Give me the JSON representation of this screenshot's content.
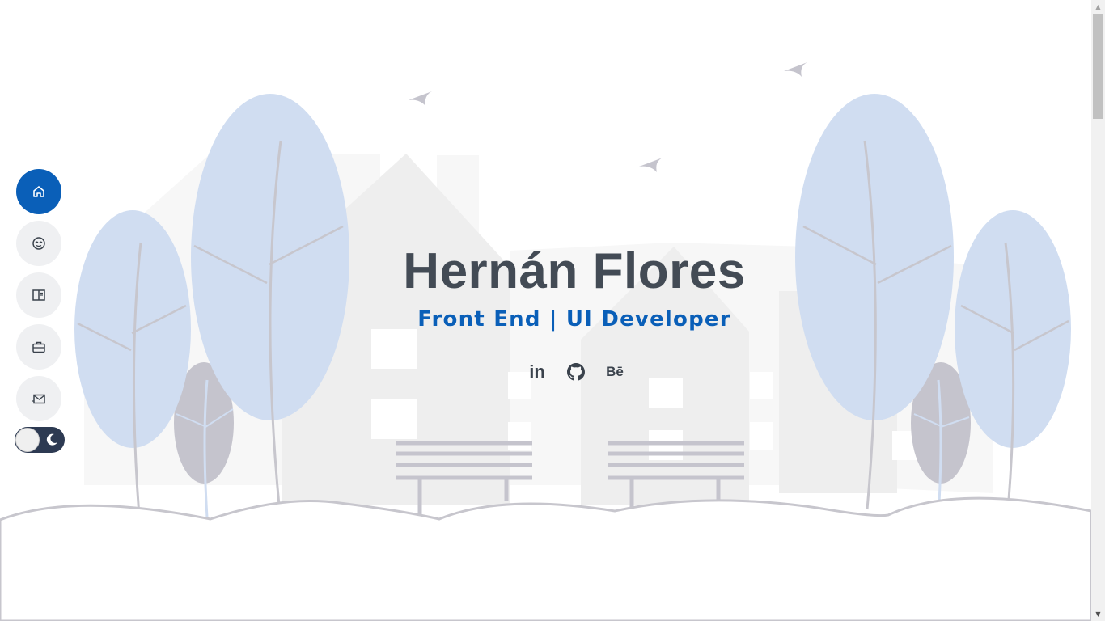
{
  "hero": {
    "name": "Hernán Flores",
    "role": "Front End | UI Developer"
  },
  "nav": {
    "items": [
      {
        "id": "home",
        "icon": "home-icon",
        "active": true
      },
      {
        "id": "about",
        "icon": "face-icon",
        "active": false
      },
      {
        "id": "resume",
        "icon": "book-icon",
        "active": false
      },
      {
        "id": "portfolio",
        "icon": "briefcase-icon",
        "active": false
      },
      {
        "id": "contact",
        "icon": "mail-icon",
        "active": false
      }
    ],
    "theme_toggle": {
      "mode": "light",
      "icon": "moon-icon"
    }
  },
  "social": {
    "linkedin": "in",
    "github_icon": "github-icon",
    "behance": "Bē"
  },
  "colors": {
    "accent": "#0a5fb8",
    "heading": "#434b55",
    "tree_blue": "#d0ddf1",
    "tree_gray": "#c5c4cd",
    "building": "#eeeeee",
    "line": "#c7c6cd"
  }
}
